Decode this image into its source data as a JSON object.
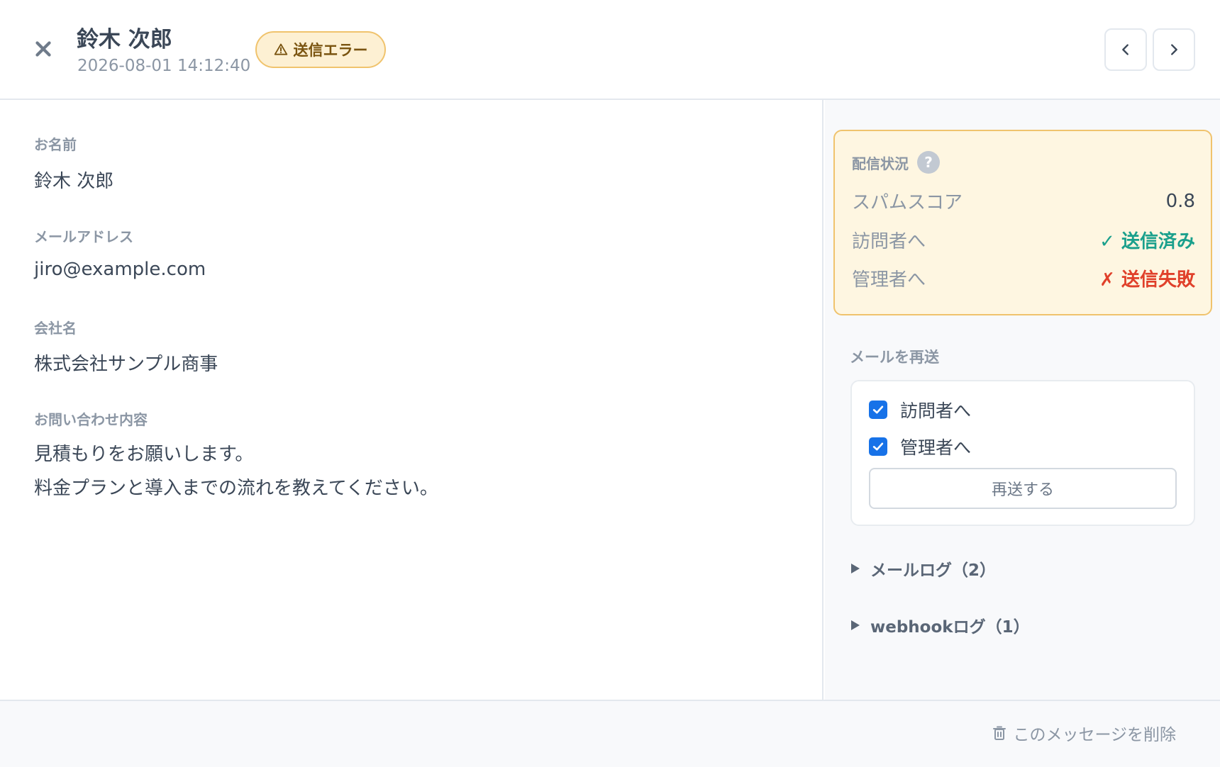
{
  "header": {
    "name": "鈴木 次郎",
    "datetime": "2026-08-01 14:12:40",
    "badge": "送信エラー",
    "icons": {
      "close": "close-icon",
      "badge": "warning-icon",
      "prev": "chevron-left-icon",
      "next": "chevron-right-icon"
    }
  },
  "fields": [
    {
      "label": "お名前",
      "value": "鈴木 次郎"
    },
    {
      "label": "メールアドレス",
      "value": "jiro@example.com"
    },
    {
      "label": "会社名",
      "value": "株式会社サンプル商事"
    },
    {
      "label": "お問い合わせ内容",
      "lines": [
        "見積もりをお願いします。",
        "料金プランと導入までの流れを教えてください。"
      ]
    }
  ],
  "delivery": {
    "title": "配信状況",
    "help": "?",
    "rows": [
      {
        "label": "スパムスコア",
        "value": "0.8"
      },
      {
        "label": "訪問者へ",
        "value": "✓ 送信済み",
        "status": "success"
      },
      {
        "label": "管理者へ",
        "value": "✗ 送信失敗",
        "status": "error"
      }
    ]
  },
  "resend": {
    "title": "メールを再送",
    "options": [
      {
        "label": "訪問者へ",
        "checked": true
      },
      {
        "label": "管理者へ",
        "checked": true
      }
    ],
    "button": "再送する"
  },
  "logs": [
    {
      "label": "メールログ（2）"
    },
    {
      "label": "webhookログ（1）"
    }
  ],
  "footer": {
    "delete": "このメッセージを削除",
    "delete_icon": "trash-icon"
  },
  "colors": {
    "accent": "#1772e8",
    "warning_border": "#f0c36d",
    "warning_bg": "#fef6e1",
    "success": "#1aa08c",
    "error": "#e0402a"
  }
}
